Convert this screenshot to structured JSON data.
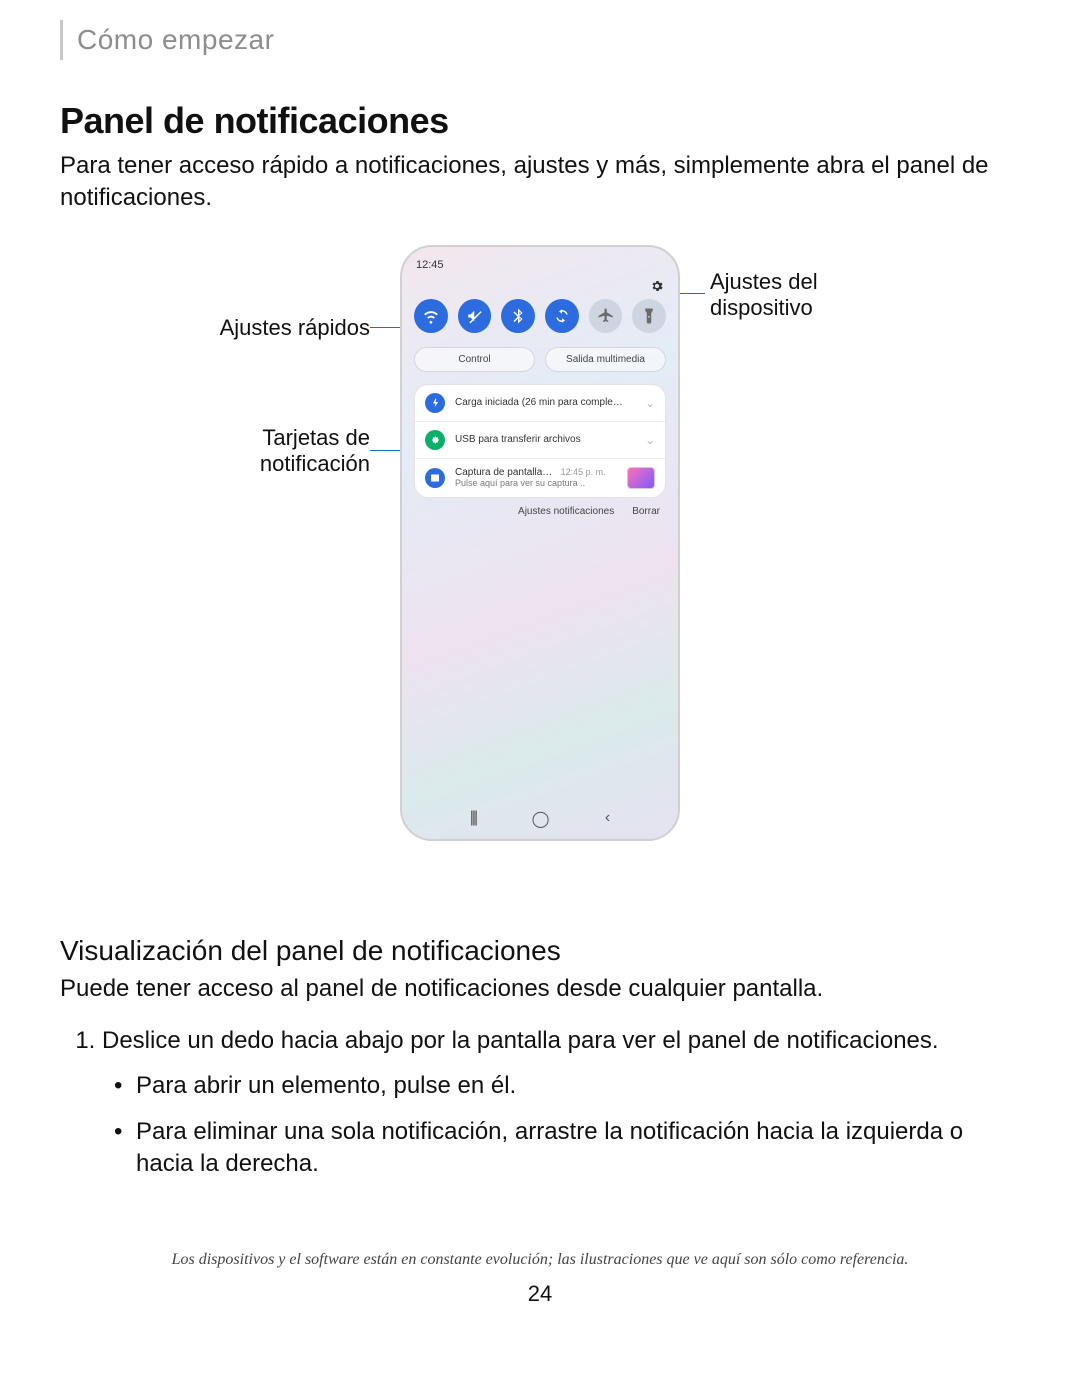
{
  "breadcrumb": "Cómo empezar",
  "title": "Panel de notificaciones",
  "intro": "Para tener acceso rápido a notificaciones, ajustes y más, simplemente abra el panel de notificaciones.",
  "callouts": {
    "quick_settings": "Ajustes rápidos",
    "device_settings_line1": "Ajustes del",
    "device_settings_line2": "dispositivo",
    "notif_cards_line1": "Tarjetas de",
    "notif_cards_line2": "notificación"
  },
  "phone": {
    "time": "12:45",
    "pills": {
      "control": "Control",
      "media": "Salida multimedia"
    },
    "notifications": {
      "charging": "Carga iniciada (26 min para comple…",
      "usb": "USB para transferir archivos",
      "screenshot_title": "Captura de pantalla…",
      "screenshot_time": "12:45 p. m.",
      "screenshot_sub": "Pulse aquí para ver su captura .."
    },
    "actions": {
      "settings": "Ajustes notificaciones",
      "clear": "Borrar"
    },
    "nav": {
      "recent": "|||",
      "home": "◯",
      "back": "‹"
    }
  },
  "subtitle": "Visualización del panel de notificaciones",
  "sub_intro": "Puede tener acceso al panel de notificaciones desde cualquier pantalla.",
  "list": {
    "step1": "Deslice un dedo hacia abajo por la pantalla para ver el panel de notificaciones.",
    "bullet1": "Para abrir un elemento, pulse en él.",
    "bullet2": "Para eliminar una sola notificación, arrastre la notificación hacia la izquierda o hacia la derecha."
  },
  "footnote": "Los dispositivos y el software están en constante evolución; las ilustraciones que ve aquí son sólo como referencia.",
  "page_number": "24"
}
